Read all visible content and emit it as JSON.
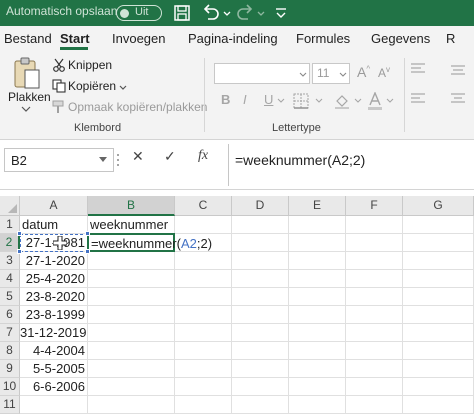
{
  "titlebar": {
    "autosave_label": "Automatisch opslaan",
    "autosave_state": "Uit"
  },
  "tabs": [
    "Bestand",
    "Start",
    "Invoegen",
    "Pagina-indeling",
    "Formules",
    "Gegevens"
  ],
  "active_tab": "Start",
  "ribbon": {
    "clipboard": {
      "paste_label": "Plakken",
      "cut_label": "Knippen",
      "copy_label": "Kopiëren",
      "format_painter_label": "Opmaak kopiëren/plakken",
      "group_label": "Klembord"
    },
    "font": {
      "font_name": "",
      "font_size": "11",
      "bold": "B",
      "italic": "I",
      "underline": "U",
      "group_label": "Lettertype"
    }
  },
  "formula_bar": {
    "name_box": "B2",
    "cancel_icon": "✕",
    "enter_icon": "✓",
    "fx_label": "fx",
    "formula": "=weeknummer(A2;2)"
  },
  "grid": {
    "columns": [
      "A",
      "B",
      "C",
      "D",
      "E",
      "F",
      "G"
    ],
    "rows": [
      "1",
      "2",
      "3",
      "4",
      "5",
      "6",
      "7",
      "8",
      "9",
      "10",
      "11"
    ],
    "col_a": [
      "datum",
      "27-1-1981",
      "27-1-2020",
      "25-4-2020",
      "23-8-2020",
      "23-8-1999",
      "31-12-2019",
      "4-4-2004",
      "5-5-2005",
      "6-6-2006",
      ""
    ],
    "col_b": [
      "weeknummer",
      "",
      "",
      "",
      "",
      "",
      "",
      "",
      "",
      "",
      ""
    ],
    "editing_cell": {
      "prefix": "=weeknummer(",
      "ref": "A2",
      "suffix": ";2)"
    },
    "selected_column": "B",
    "selected_row": "2"
  },
  "colors": {
    "excel_green": "#217346",
    "reference_blue": "#4472c4"
  }
}
